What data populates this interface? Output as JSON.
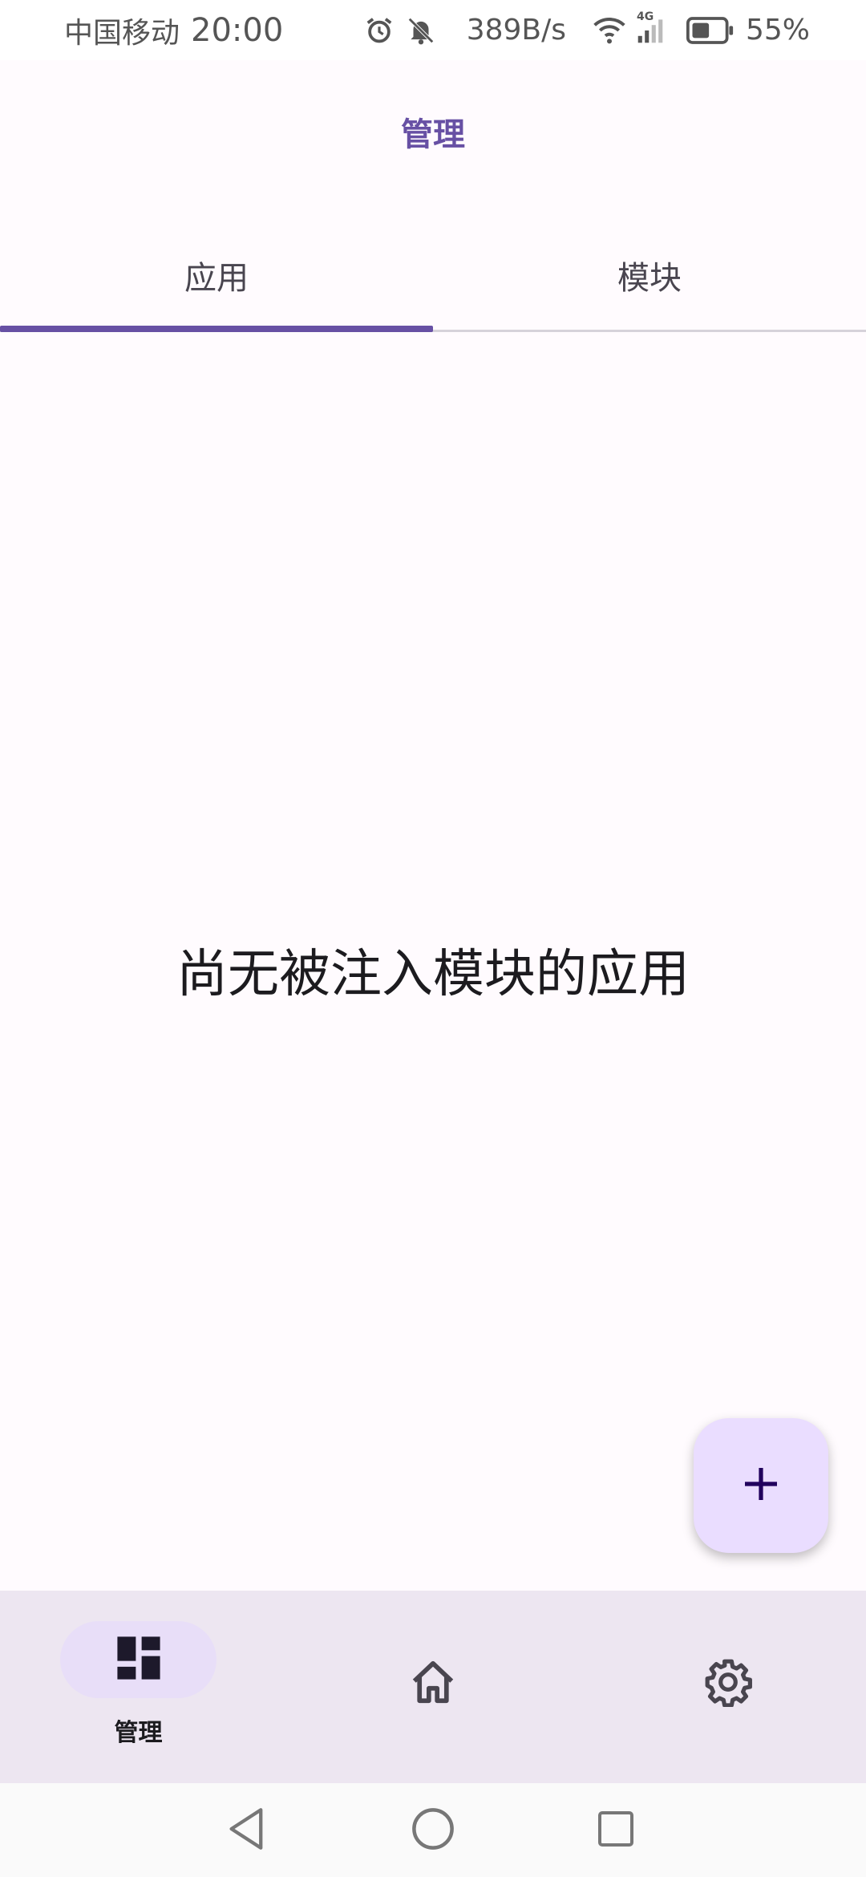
{
  "status_bar": {
    "carrier": "中国移动",
    "time": "20:00",
    "net_speed": "389B/s",
    "network_type": "4G",
    "battery": "55%",
    "battery_level": 0.55,
    "icons": [
      "alarm-icon",
      "bell-off-icon",
      "wifi-icon",
      "signal-icon",
      "battery-icon"
    ]
  },
  "header": {
    "title": "管理"
  },
  "tabs": [
    {
      "label": "应用",
      "selected": true
    },
    {
      "label": "模块",
      "selected": false
    }
  ],
  "main": {
    "empty_message": "尚无被注入模块的应用"
  },
  "fab": {
    "icon": "plus-icon"
  },
  "bottom_nav": {
    "items": [
      {
        "label": "管理",
        "icon": "dashboard-icon",
        "selected": true
      },
      {
        "label": "",
        "icon": "home-icon",
        "selected": false
      },
      {
        "label": "",
        "icon": "gear-icon",
        "selected": false
      }
    ]
  },
  "system_nav": {
    "icons": [
      "back-icon",
      "home-circle-icon",
      "recents-icon"
    ]
  },
  "colors": {
    "accent": "#6750a4",
    "background": "#fffbfe",
    "fab": "#eaddff",
    "nav_bar": "#ede6f1",
    "nav_pill": "#e8def8"
  }
}
